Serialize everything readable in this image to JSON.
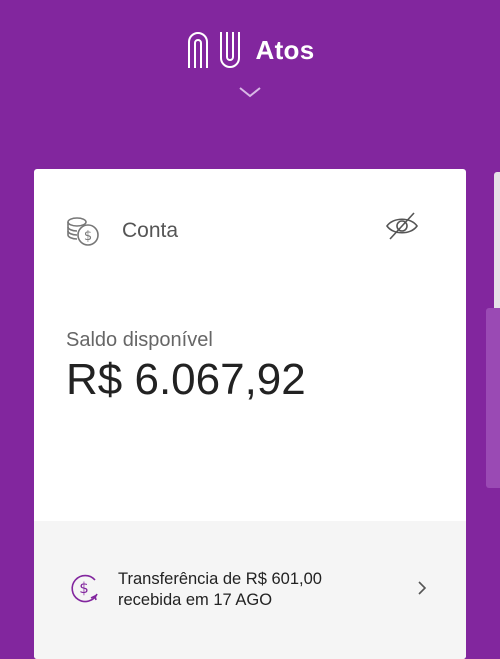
{
  "header": {
    "logo": "nu-logo",
    "user_name": "Atos",
    "expand_icon": "chevron-down-icon"
  },
  "account_card": {
    "icon": "coins-icon",
    "title": "Conta",
    "hide_icon": "eye-off-icon",
    "balance_label": "Saldo disponível",
    "balance_value": "R$ 6.067,92",
    "notification": {
      "icon": "money-received-icon",
      "line1": "Transferência de R$ 601,00",
      "line2": "recebida em 17 AGO",
      "chevron_icon": "chevron-right-icon"
    }
  },
  "colors": {
    "brand_purple": "#82269e",
    "card_bg": "#ffffff",
    "footer_bg": "#f5f5f5"
  }
}
